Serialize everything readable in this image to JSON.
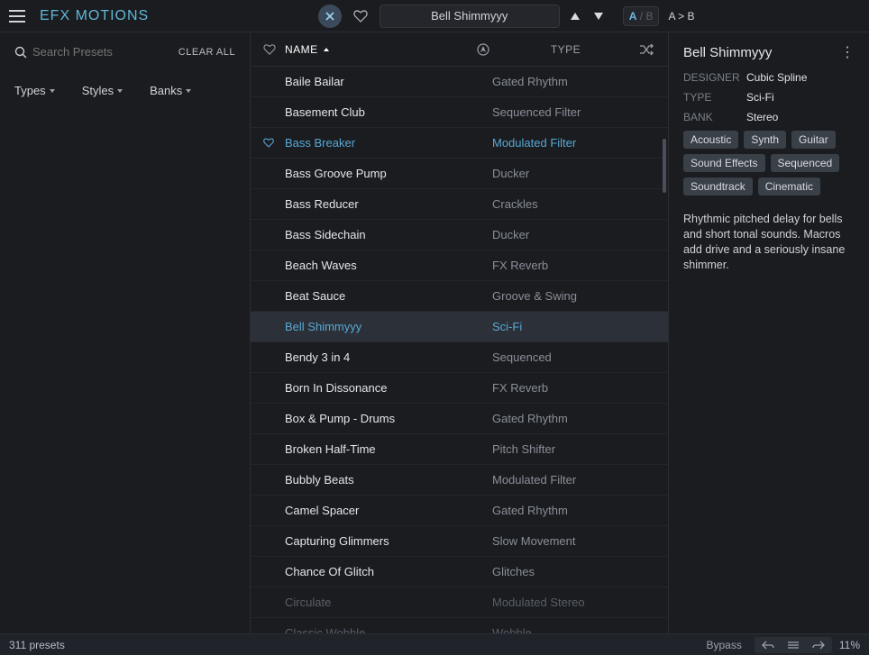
{
  "header": {
    "logo": "EFX MOTIONS",
    "preset_name": "Bell Shimmyyy",
    "ab_a": "A",
    "ab_sep": "/",
    "ab_b": "B",
    "ab_copy": "A > B"
  },
  "sidebar": {
    "search_placeholder": "Search Presets",
    "clear_all": "CLEAR ALL",
    "filters": {
      "types": "Types",
      "styles": "Styles",
      "banks": "Banks"
    }
  },
  "list": {
    "columns": {
      "name": "NAME",
      "type": "TYPE"
    },
    "rows": [
      {
        "name": "Baile Bailar",
        "type": "Gated Rhythm",
        "state": ""
      },
      {
        "name": "Basement Club",
        "type": "Sequenced Filter",
        "state": ""
      },
      {
        "name": "Bass Breaker",
        "type": "Modulated Filter",
        "state": "fav"
      },
      {
        "name": "Bass Groove Pump",
        "type": "Ducker",
        "state": ""
      },
      {
        "name": "Bass Reducer",
        "type": "Crackles",
        "state": ""
      },
      {
        "name": "Bass Sidechain",
        "type": "Ducker",
        "state": ""
      },
      {
        "name": "Beach Waves",
        "type": "FX Reverb",
        "state": ""
      },
      {
        "name": "Beat Sauce",
        "type": "Groove & Swing",
        "state": ""
      },
      {
        "name": "Bell Shimmyyy",
        "type": "Sci-Fi",
        "state": "selected"
      },
      {
        "name": "Bendy 3 in 4",
        "type": "Sequenced",
        "state": ""
      },
      {
        "name": "Born In Dissonance",
        "type": "FX Reverb",
        "state": ""
      },
      {
        "name": "Box & Pump - Drums",
        "type": "Gated Rhythm",
        "state": ""
      },
      {
        "name": "Broken Half-Time",
        "type": "Pitch Shifter",
        "state": ""
      },
      {
        "name": "Bubbly Beats",
        "type": "Modulated Filter",
        "state": ""
      },
      {
        "name": "Camel Spacer",
        "type": "Gated Rhythm",
        "state": ""
      },
      {
        "name": "Capturing Glimmers",
        "type": "Slow Movement",
        "state": ""
      },
      {
        "name": "Chance Of Glitch",
        "type": "Glitches",
        "state": ""
      },
      {
        "name": "Circulate",
        "type": "Modulated Stereo",
        "state": "faded"
      },
      {
        "name": "Classic Wobble",
        "type": "Wobble",
        "state": "faded"
      }
    ]
  },
  "detail": {
    "title": "Bell Shimmyyy",
    "designer_label": "DESIGNER",
    "designer": "Cubic Spline",
    "type_label": "TYPE",
    "type": "Sci-Fi",
    "bank_label": "BANK",
    "bank": "Stereo",
    "tags": [
      "Acoustic",
      "Synth",
      "Guitar",
      "Sound Effects",
      "Sequenced",
      "Soundtrack",
      "Cinematic"
    ],
    "description": "Rhythmic pitched delay for bells and short tonal sounds. Macros add drive and a seriously insane shimmer."
  },
  "footer": {
    "preset_count": "311 presets",
    "bypass": "Bypass",
    "cpu": "11%"
  }
}
